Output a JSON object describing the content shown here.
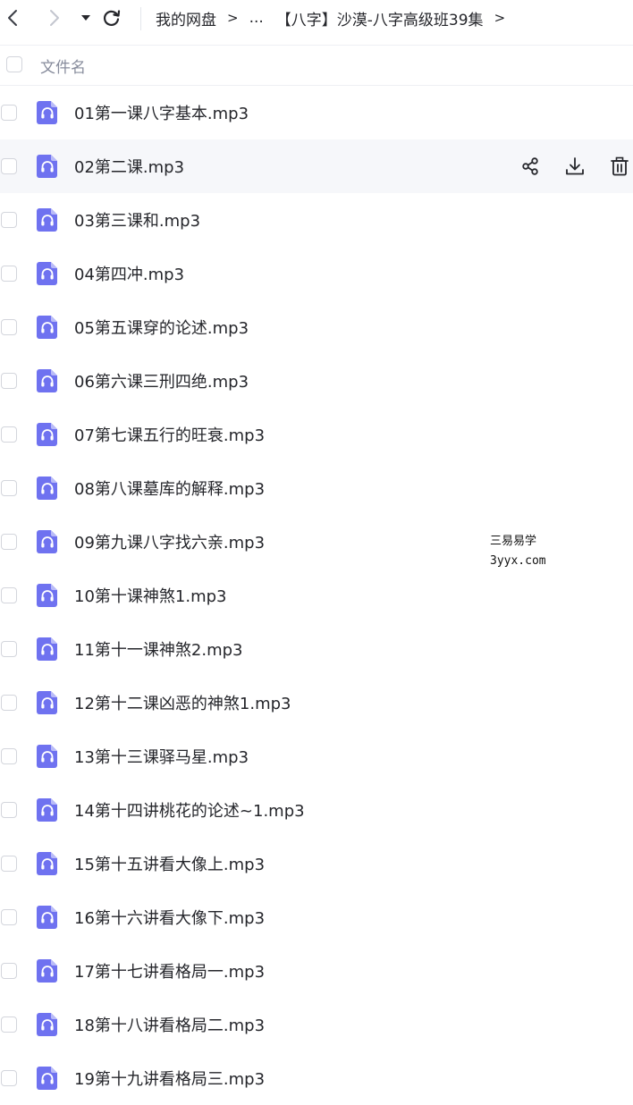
{
  "nav": {
    "back_icon": "chevron-left-icon",
    "forward_icon": "chevron-right-icon",
    "dropdown_icon": "caret-down-icon",
    "refresh_icon": "refresh-icon"
  },
  "breadcrumb": {
    "root": "我的网盘",
    "ellipsis": "...",
    "current": "【八字】沙漠-八字高级班39集",
    "separator": ">"
  },
  "list_header": {
    "column_label": "文件名"
  },
  "row_actions": {
    "share_icon": "share-icon",
    "download_icon": "download-icon",
    "delete_icon": "trash-icon"
  },
  "files": [
    {
      "name": "01第一课八字基本.mp3"
    },
    {
      "name": "02第二课.mp3"
    },
    {
      "name": "03第三课和.mp3"
    },
    {
      "name": "04第四冲.mp3"
    },
    {
      "name": "05第五课穿的论述.mp3"
    },
    {
      "name": "06第六课三刑四绝.mp3"
    },
    {
      "name": "07第七课五行的旺衰.mp3"
    },
    {
      "name": "08第八课墓库的解释.mp3"
    },
    {
      "name": "09第九课八字找六亲.mp3"
    },
    {
      "name": "10第十课神煞1.mp3"
    },
    {
      "name": "11第十一课神煞2.mp3"
    },
    {
      "name": "12第十二课凶恶的神煞1.mp3"
    },
    {
      "name": "13第十三课驿马星.mp3"
    },
    {
      "name": "14第十四讲桃花的论述~1.mp3"
    },
    {
      "name": "15第十五讲看大像上.mp3"
    },
    {
      "name": "16第十六讲看大像下.mp3"
    },
    {
      "name": "17第十七讲看格局一.mp3"
    },
    {
      "name": "18第十八讲看格局二.mp3"
    },
    {
      "name": "19第十九讲看格局三.mp3"
    }
  ],
  "hovered_index": 1,
  "watermark": {
    "line1": "三易易学",
    "line2": "3yyx.com"
  },
  "colors": {
    "icon_bg": "#6f72f0",
    "text": "#25262b",
    "muted": "#878c9c",
    "hover_bg": "#f6f7fa"
  }
}
